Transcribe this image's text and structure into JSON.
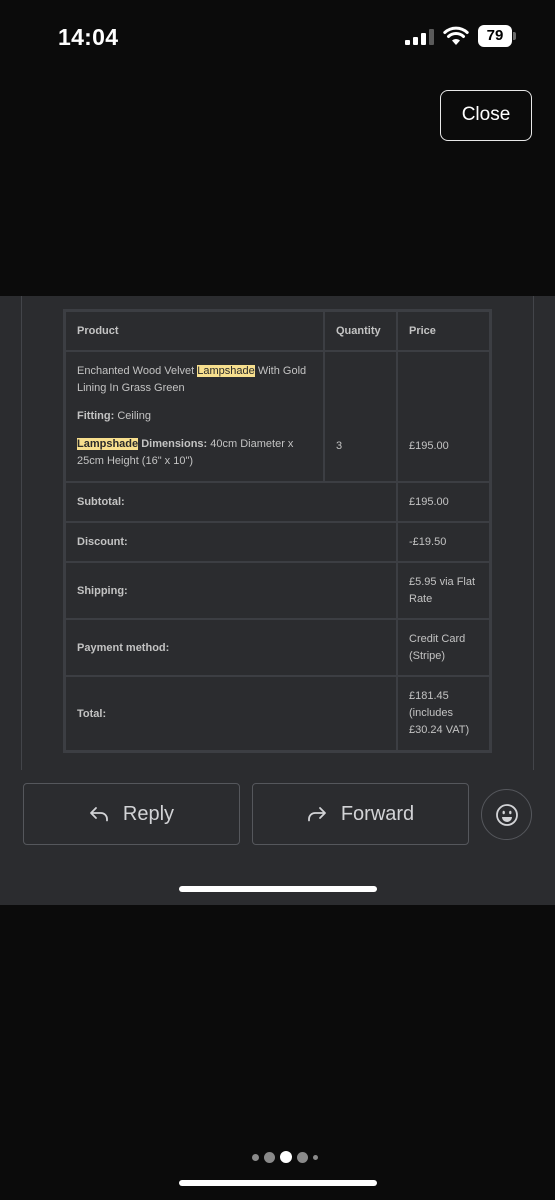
{
  "status_bar": {
    "time": "14:04",
    "battery": "79"
  },
  "close_label": "Close",
  "order": {
    "headers": {
      "product": "Product",
      "quantity": "Quantity",
      "price": "Price"
    },
    "item": {
      "name_before": "Enchanted Wood Velvet ",
      "name_highlight": "Lampshade",
      "name_after": " With Gold Lining In Grass Green",
      "fitting_label": "Fitting:",
      "fitting_value": " Ceiling",
      "dimensions_highlight": "Lampshade",
      "dimensions_label": " Dimensions:",
      "dimensions_value": " 40cm Diameter x 25cm Height (16\" x 10\")",
      "quantity": "3",
      "price": "£195.00"
    },
    "summary": [
      {
        "label": "Subtotal:",
        "value": "£195.00"
      },
      {
        "label": "Discount:",
        "value": "-£19.50"
      },
      {
        "label": "Shipping:",
        "value": "£5.95 via Flat Rate"
      },
      {
        "label": "Payment method:",
        "value": "Credit Card (Stripe)"
      },
      {
        "label": "Total:",
        "value": "£181.45 (includes £30.24 VAT)"
      }
    ]
  },
  "actions": {
    "reply": "Reply",
    "forward": "Forward"
  },
  "icons": {
    "reply": "reply-arrow-icon",
    "forward": "forward-arrow-icon",
    "emoji": "smiley-icon"
  },
  "pagination": {
    "pages": 5,
    "current": 3
  }
}
